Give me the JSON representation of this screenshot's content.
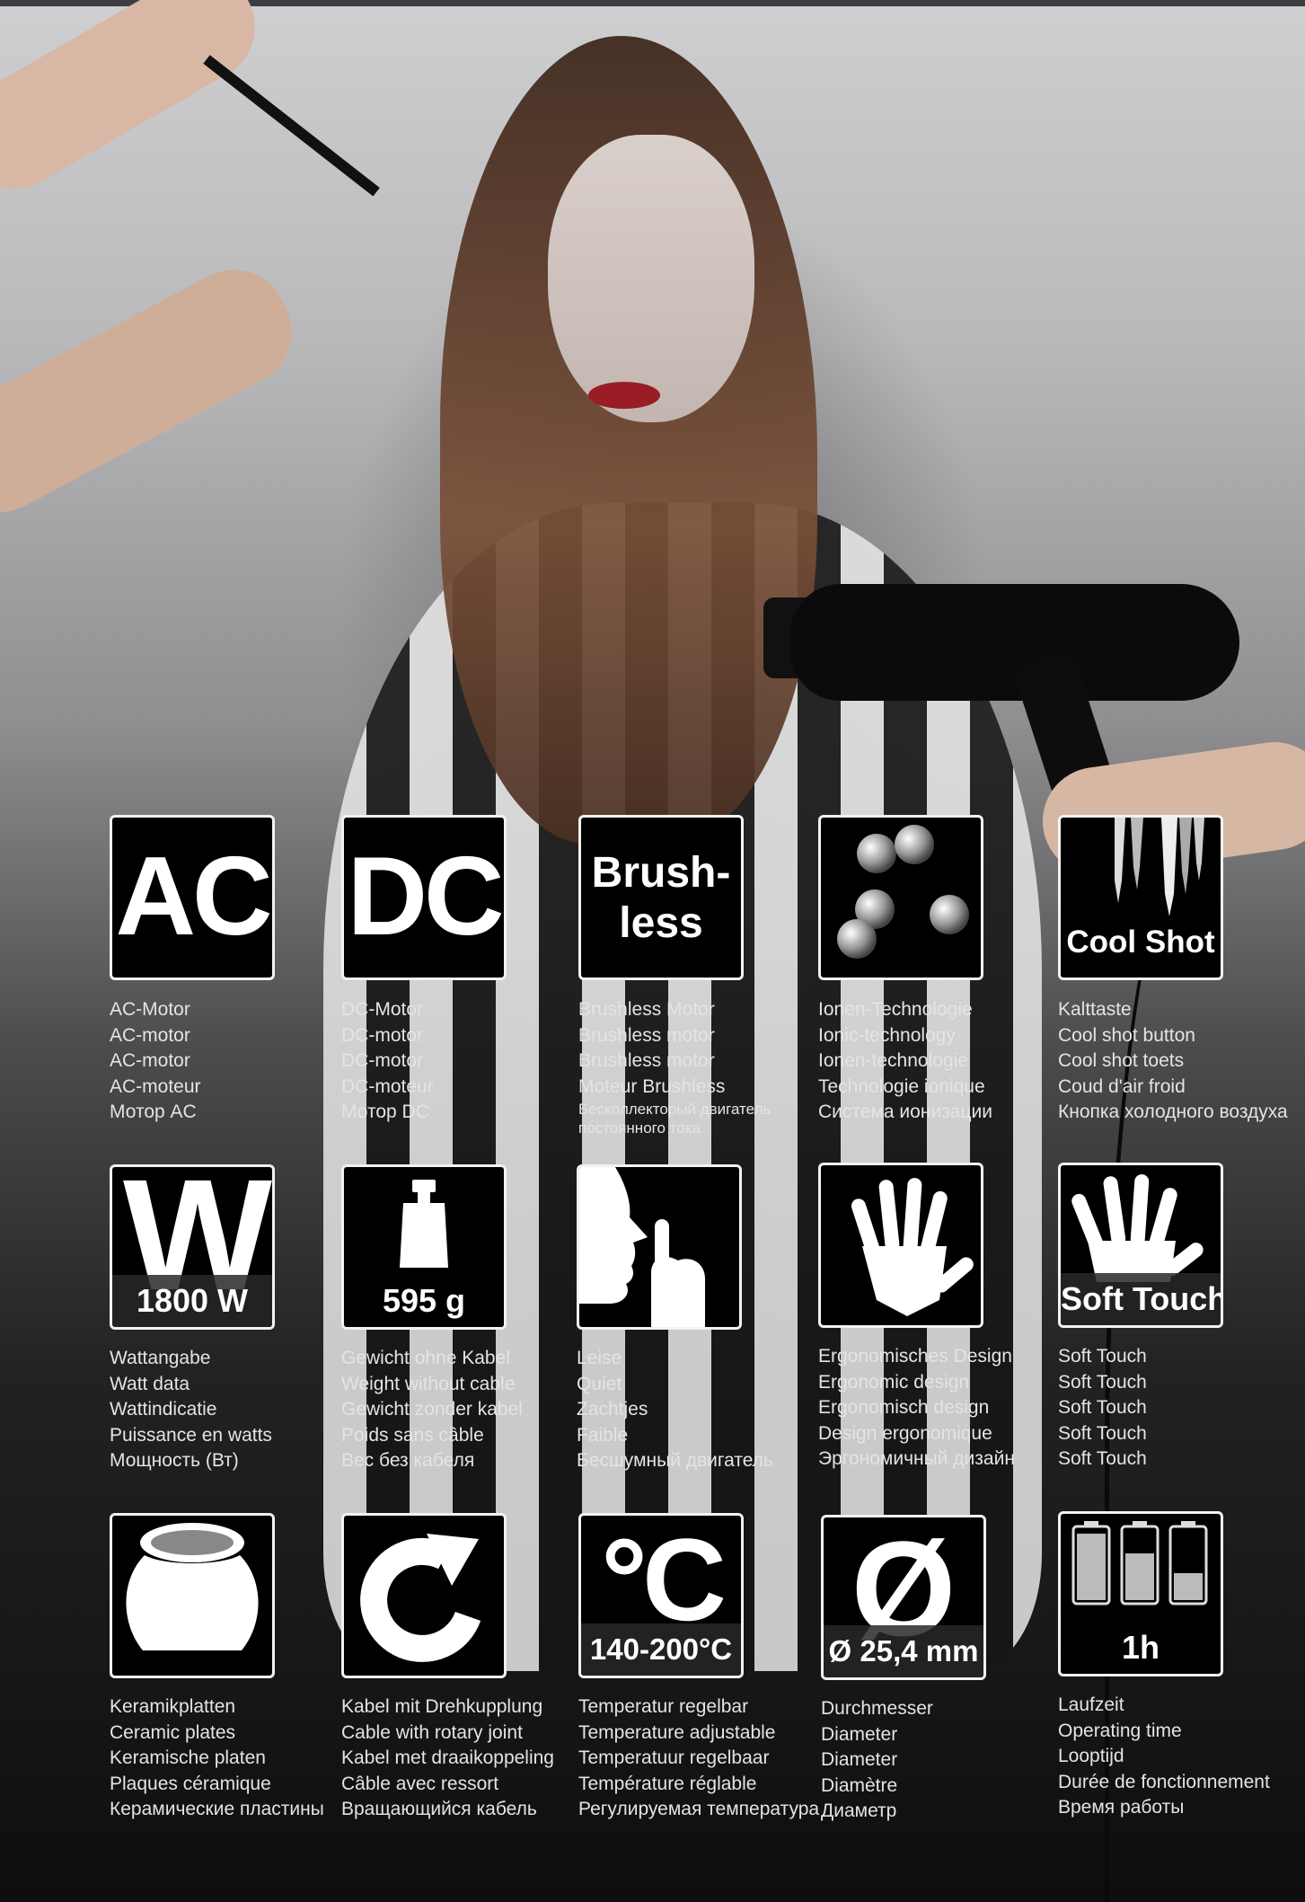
{
  "features": [
    {
      "icon": "ac-icon",
      "title": "AC",
      "labels": [
        "AC-Motor",
        "AC-motor",
        "AC-motor",
        "AC-moteur",
        "Мотор AC"
      ]
    },
    {
      "icon": "dc-icon",
      "title": "DC",
      "labels": [
        "DC-Motor",
        "DC-motor",
        "DC-motor",
        "DC-moteur",
        "Мотор DC"
      ]
    },
    {
      "icon": "brushless-icon",
      "title_line1": "Brush-",
      "title_line2": "less",
      "labels": [
        "Brushless Motor",
        "Brushless motor",
        "Brushless motor",
        "Moteur Brushless",
        "Бесколлекторый двигатель",
        "постоянного тока"
      ]
    },
    {
      "icon": "ions-icon",
      "labels": [
        "Ionen-Technologie",
        "Ionic-technology",
        "Ionen-technologie",
        "Technologie ionique",
        "Система ионизации"
      ]
    },
    {
      "icon": "icicles-icon",
      "title": "Cool Shot",
      "labels": [
        "Kalttaste",
        "Cool shot button",
        "Cool shot toets",
        "Coud d'air froid",
        "Кнопка холодного воздуха"
      ]
    },
    {
      "icon": "watt-icon",
      "title": "W",
      "value": "1800 W",
      "labels": [
        "Wattangabe",
        "Watt data",
        "Wattindicatie",
        "Puissance en watts",
        "Мощность (Вт)"
      ]
    },
    {
      "icon": "weight-icon",
      "value": "595 g",
      "labels": [
        "Gewicht ohne Kabel",
        "Weight without cable",
        "Gewicht zonder kabel",
        "Poids sans câble",
        "Вес без кабеля"
      ]
    },
    {
      "icon": "silence-icon",
      "labels": [
        "Leise",
        "Quiet",
        "Zachtjes",
        "Faible",
        "Бесшумный двигатель"
      ]
    },
    {
      "icon": "hand-icon",
      "labels": [
        "Ergonomisches Design",
        "Ergonomic design",
        "Ergonomisch design",
        "Design ergonomique",
        "Эргономичный дизайн"
      ]
    },
    {
      "icon": "soft-touch-icon",
      "title": "Soft Touch",
      "labels": [
        "Soft Touch",
        "Soft Touch",
        "Soft Touch",
        "Soft Touch",
        "Soft Touch"
      ]
    },
    {
      "icon": "ceramic-pot-icon",
      "labels": [
        "Keramikplatten",
        "Ceramic plates",
        "Keramische platen",
        "Plaques céramique",
        "Керамические пластины"
      ]
    },
    {
      "icon": "rotate-arrow-icon",
      "labels": [
        "Kabel mit Drehkupplung",
        "Cable with rotary joint",
        "Kabel met draaikoppeling",
        "Câble avec ressort",
        "Вращающийся кабель"
      ]
    },
    {
      "icon": "temperature-icon",
      "title": "°C",
      "value": "140-200°C",
      "labels": [
        "Temperatur regelbar",
        "Temperature adjustable",
        "Temperatuur regelbaar",
        "Température réglable",
        "Регулируемая температура"
      ]
    },
    {
      "icon": "diameter-icon",
      "title": "Ø",
      "value": "Ø 25,4 mm",
      "labels": [
        "Durchmesser",
        "Diameter",
        "Diameter",
        "Diamètre",
        "Диаметр"
      ]
    },
    {
      "icon": "battery-icon",
      "value": "1h",
      "labels": [
        "Laufzeit",
        "Operating time",
        "Looptijd",
        "Durée de fonctionnement",
        "Время работы"
      ]
    }
  ]
}
